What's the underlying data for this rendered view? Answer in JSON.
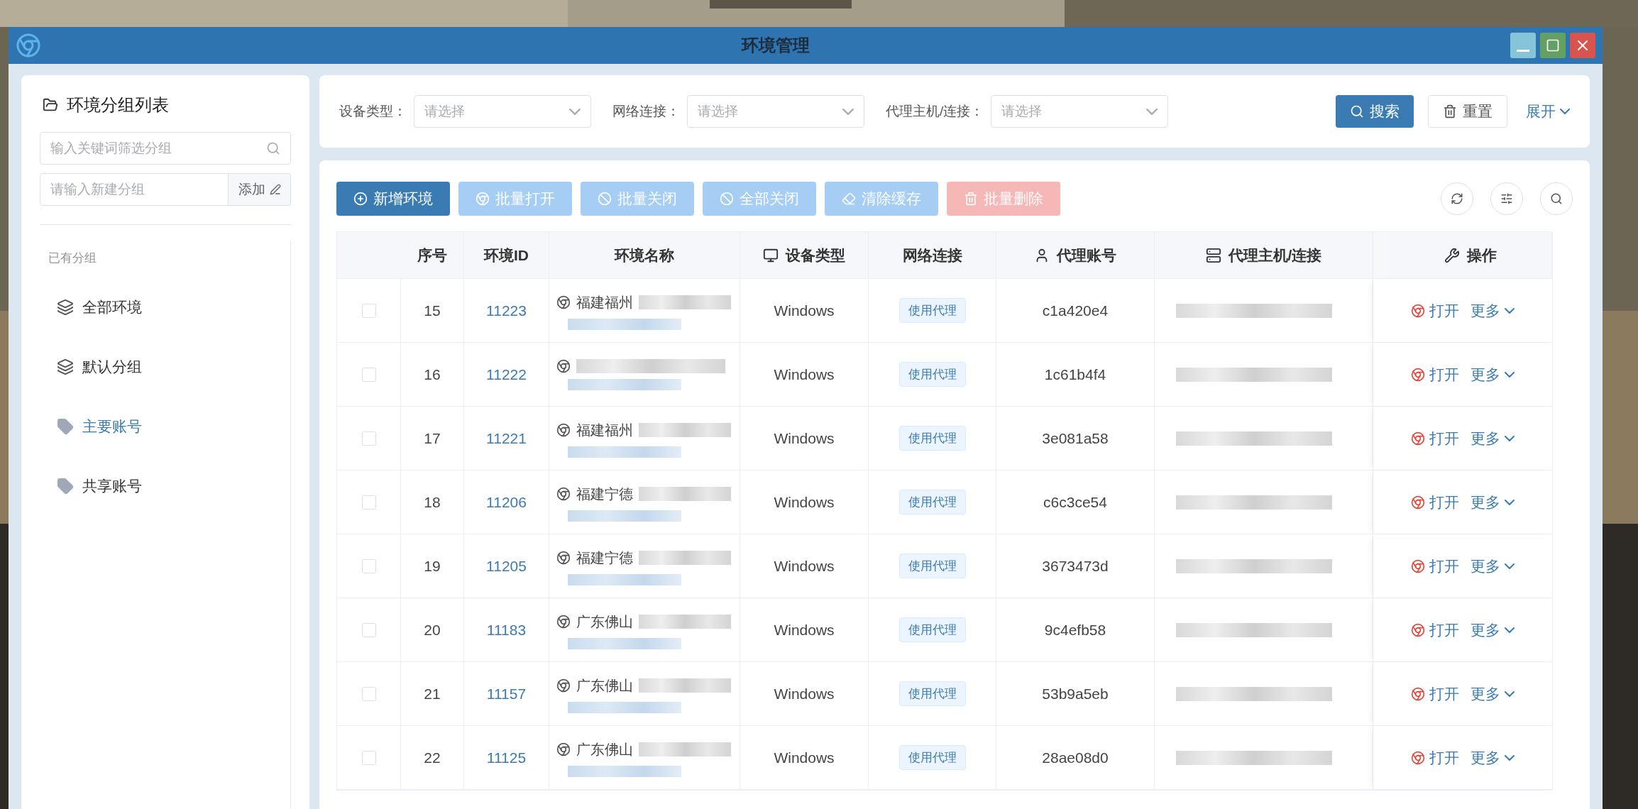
{
  "window": {
    "title": "环境管理"
  },
  "sidebar": {
    "title": "环境分组列表",
    "search_placeholder": "输入关键词筛选分组",
    "new_group_placeholder": "请输入新建分组",
    "add_button": "添加",
    "section_label": "已有分组",
    "groups": [
      {
        "label": "全部环境",
        "kind": "layers",
        "selected": false
      },
      {
        "label": "默认分组",
        "kind": "layers",
        "selected": false
      },
      {
        "label": "主要账号",
        "kind": "tag",
        "selected": true
      },
      {
        "label": "共享账号",
        "kind": "tag",
        "selected": false
      }
    ]
  },
  "filters": [
    {
      "label": "设备类型：",
      "placeholder": "请选择"
    },
    {
      "label": "网络连接：",
      "placeholder": "请选择"
    },
    {
      "label": "代理主机/连接：",
      "placeholder": "请选择"
    }
  ],
  "search_button": "搜索",
  "reset_button": "重置",
  "expand_link": "展开",
  "toolbar": [
    {
      "label": "新增环境",
      "kind": "add",
      "disabled": false
    },
    {
      "label": "批量打开",
      "kind": "open",
      "disabled": true
    },
    {
      "label": "批量关闭",
      "kind": "close",
      "disabled": true
    },
    {
      "label": "全部关闭",
      "kind": "close",
      "disabled": true
    },
    {
      "label": "清除缓存",
      "kind": "clear",
      "disabled": true
    },
    {
      "label": "批量删除",
      "kind": "delete",
      "disabled": true
    }
  ],
  "table": {
    "columns": [
      "序号",
      "环境ID",
      "环境名称",
      "设备类型",
      "网络连接",
      "代理账号",
      "代理主机/连接",
      "操作"
    ],
    "rows": [
      {
        "no": "15",
        "id": "11223",
        "name": "福建福州",
        "device": "Windows",
        "network": "使用代理",
        "account": "c1a420e4",
        "checked": false,
        "actions": [
          "打开",
          "更多"
        ]
      },
      {
        "no": "16",
        "id": "11222",
        "name": "",
        "device": "Windows",
        "network": "使用代理",
        "account": "1c61b4f4",
        "checked": false,
        "actions": [
          "打开",
          "更多"
        ]
      },
      {
        "no": "17",
        "id": "11221",
        "name": "福建福州",
        "device": "Windows",
        "network": "使用代理",
        "account": "3e081a58",
        "checked": false,
        "actions": [
          "打开",
          "更多"
        ]
      },
      {
        "no": "18",
        "id": "11206",
        "name": "福建宁德",
        "device": "Windows",
        "network": "使用代理",
        "account": "c6c3ce54",
        "checked": false,
        "actions": [
          "打开",
          "更多"
        ]
      },
      {
        "no": "19",
        "id": "11205",
        "name": "福建宁德",
        "device": "Windows",
        "network": "使用代理",
        "account": "3673473d",
        "checked": false,
        "actions": [
          "打开",
          "更多"
        ]
      },
      {
        "no": "20",
        "id": "11183",
        "name": "广东佛山",
        "device": "Windows",
        "network": "使用代理",
        "account": "9c4efb58",
        "checked": false,
        "actions": [
          "打开",
          "更多"
        ]
      },
      {
        "no": "21",
        "id": "11157",
        "name": "广东佛山",
        "device": "Windows",
        "network": "使用代理",
        "account": "53b9a5eb",
        "checked": false,
        "actions": [
          "打开",
          "更多"
        ]
      },
      {
        "no": "22",
        "id": "11125",
        "name": "广东佛山",
        "device": "Windows",
        "network": "使用代理",
        "account": "28ae08d0",
        "checked": false,
        "actions": [
          "打开",
          "更多"
        ]
      }
    ]
  }
}
